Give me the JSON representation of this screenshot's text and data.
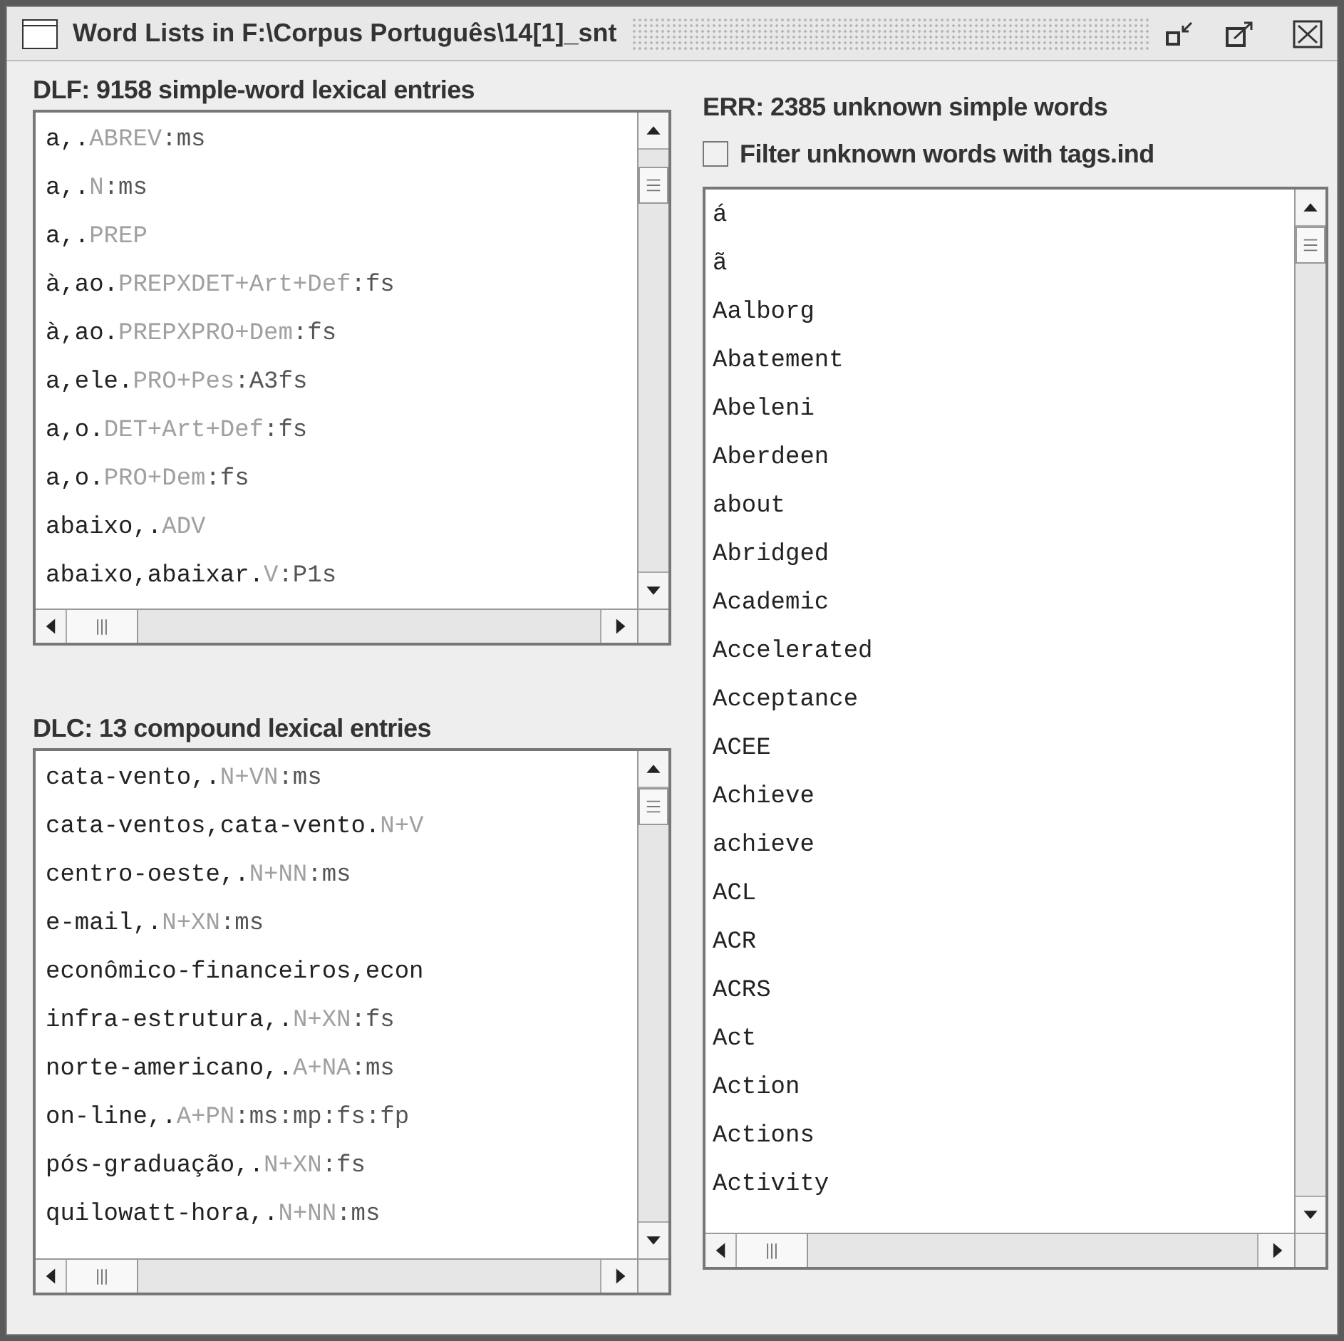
{
  "window": {
    "title": "Word Lists in F:\\Corpus Português\\14[1]_snt"
  },
  "dlf": {
    "label": "DLF: 9158 simple-word lexical entries",
    "entries": [
      {
        "head": "a,.",
        "code": "ABREV",
        "infl": ":ms"
      },
      {
        "head": "a,.",
        "code": "N",
        "infl": ":ms"
      },
      {
        "head": "a,.",
        "code": "PREP"
      },
      {
        "head": "à,ao.",
        "code": "PREPXDET+Art+Def",
        "infl": ":fs"
      },
      {
        "head": "à,ao.",
        "code": "PREPXPRO+Dem",
        "infl": ":fs"
      },
      {
        "head": "a,ele.",
        "code": "PRO+Pes",
        "infl": ":A3fs"
      },
      {
        "head": "a,o.",
        "code": "DET+Art+Def",
        "infl": ":fs"
      },
      {
        "head": "a,o.",
        "code": "PRO+Dem",
        "infl": ":fs"
      },
      {
        "head": "abaixo,.",
        "code": "ADV"
      },
      {
        "head": "abaixo,abaixar.",
        "code": "V",
        "infl": ":P1s"
      }
    ]
  },
  "dlc": {
    "label": "DLC: 13 compound lexical entries",
    "entries": [
      {
        "head": "cata-vento,.",
        "code": "N+VN",
        "infl": ":ms"
      },
      {
        "head": "cata-ventos,cata-vento.",
        "code": "N+V"
      },
      {
        "head": "centro-oeste,.",
        "code": "N+NN",
        "infl": ":ms"
      },
      {
        "head": "e-mail,.",
        "code": "N+XN",
        "infl": ":ms"
      },
      {
        "head": "econômico-financeiros,econ"
      },
      {
        "head": "infra-estrutura,.",
        "code": "N+XN",
        "infl": ":fs"
      },
      {
        "head": "norte-americano,.",
        "code": "A+NA",
        "infl": ":ms"
      },
      {
        "head": "on-line,.",
        "code": "A+PN",
        "infl": ":ms:mp:fs:fp"
      },
      {
        "head": "pós-graduação,.",
        "code": "N+XN",
        "infl": ":fs"
      },
      {
        "head": "quilowatt-hora,.",
        "code": "N+NN",
        "infl": ":ms"
      }
    ]
  },
  "err": {
    "label": "ERR: 2385 unknown simple words",
    "filter": {
      "label": "Filter unknown words with tags.ind",
      "checked": false
    },
    "words": [
      "á",
      "ã",
      "Aalborg",
      "Abatement",
      "Abeleni",
      "Aberdeen",
      "about",
      "Abridged",
      "Academic",
      "Accelerated",
      "Acceptance",
      "ACEE",
      "Achieve",
      "achieve",
      "ACL",
      "ACR",
      "ACRS",
      "Act",
      "Action",
      "Actions",
      "Activity"
    ]
  }
}
